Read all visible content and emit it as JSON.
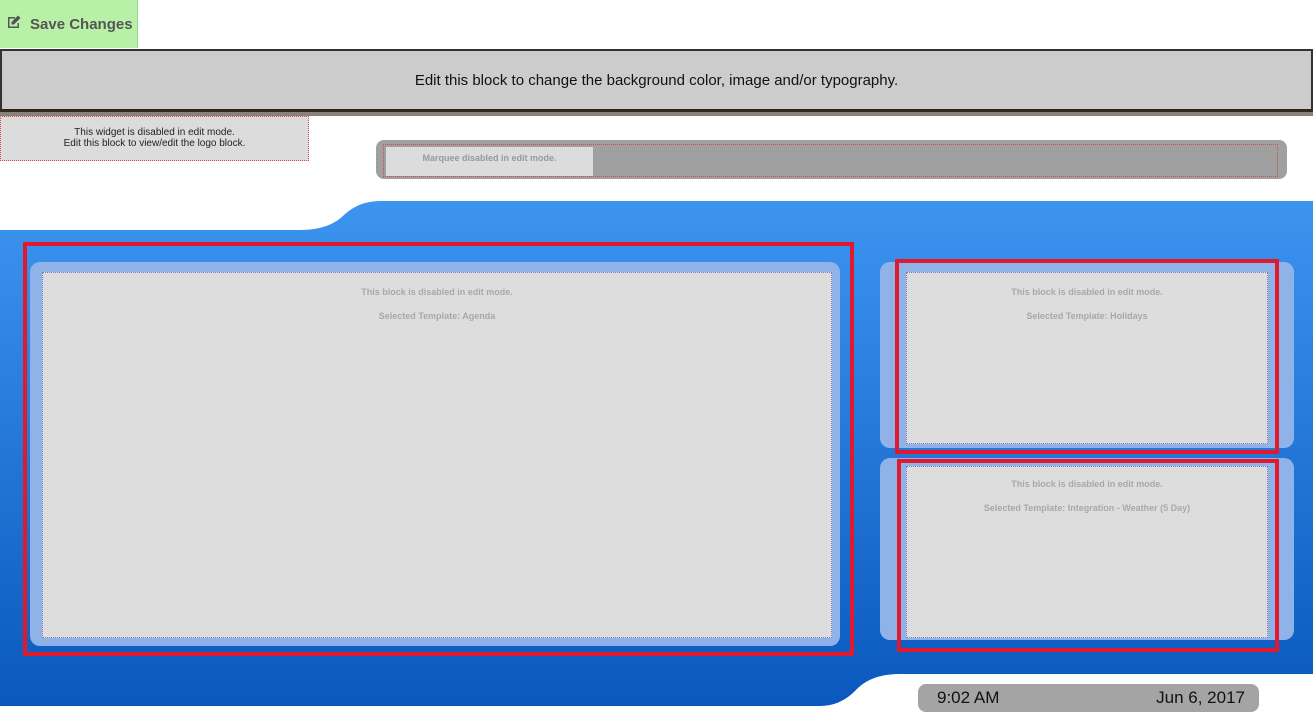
{
  "toolbar": {
    "save_label": "Save Changes",
    "save_icon": "edit-icon"
  },
  "header": {
    "text": "Edit this block to change the background color, image and/or typography."
  },
  "logo_widget": {
    "line1": "This widget is disabled in edit mode.",
    "line2": "Edit this block to view/edit the logo block."
  },
  "marquee": {
    "label": "Marquee disabled in edit mode."
  },
  "blocks": {
    "agenda": {
      "line1": "This block is disabled in edit mode.",
      "line2": "Selected Template: Agenda"
    },
    "holidays": {
      "line1": "This block is disabled in edit mode.",
      "line2": "Selected Template: Holidays"
    },
    "weather": {
      "line1": "This block is disabled in edit mode.",
      "line2": "Selected Template: Integration - Weather (5 Day)"
    }
  },
  "footer": {
    "time": "9:02 AM",
    "date": "Jun 6, 2017"
  },
  "colors": {
    "accent_red": "#e01a2e",
    "save_green": "#b8f0a8",
    "blue_bg": "#1a6fd0"
  }
}
